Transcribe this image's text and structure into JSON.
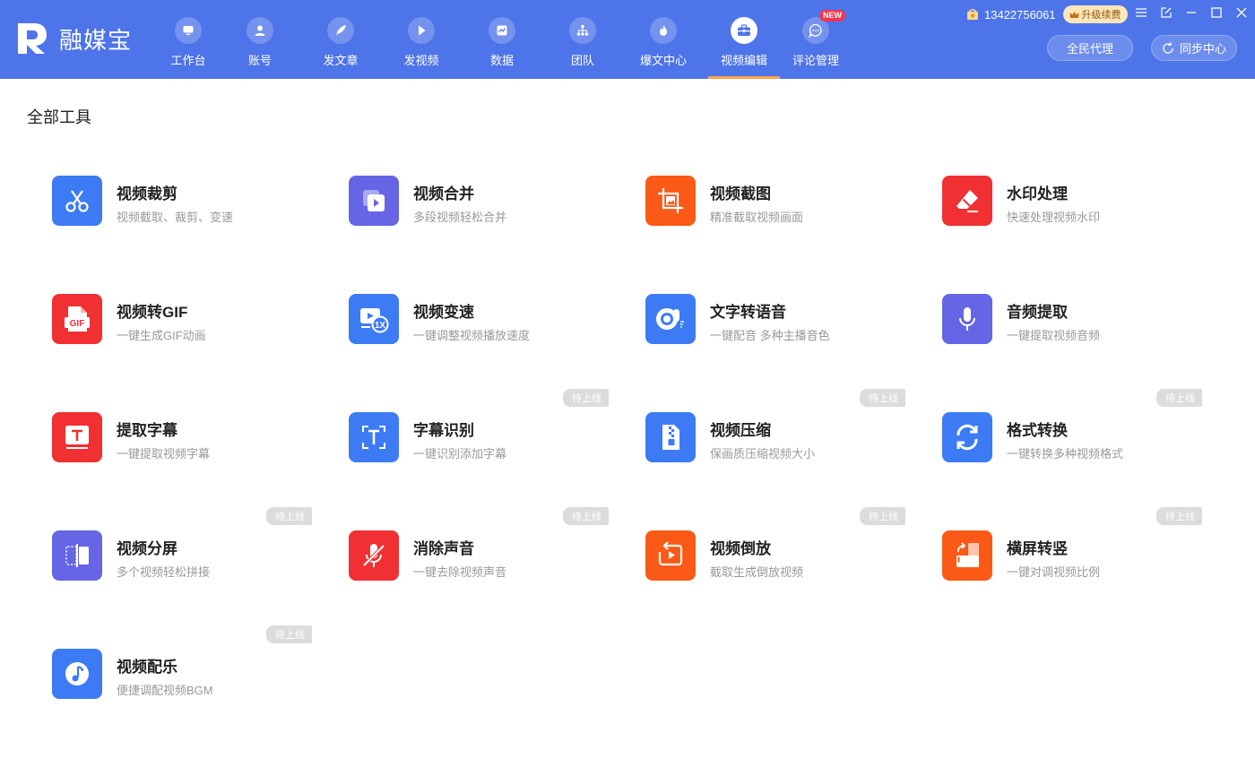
{
  "app": {
    "logo_text": "融媒宝"
  },
  "nav": [
    {
      "label": "工作台",
      "icon": "monitor-icon"
    },
    {
      "label": "账号",
      "icon": "user-icon"
    },
    {
      "label": "发文章",
      "icon": "feather-icon"
    },
    {
      "label": "发视频",
      "icon": "play-icon"
    },
    {
      "label": "数据",
      "icon": "chart-icon"
    },
    {
      "label": "团队",
      "icon": "team-icon"
    },
    {
      "label": "爆文中心",
      "icon": "flame-icon"
    },
    {
      "label": "视频编辑",
      "icon": "toolbox-icon",
      "active": true
    },
    {
      "label": "评论管理",
      "icon": "comment-icon",
      "badge": "NEW"
    }
  ],
  "account": {
    "phone": "13422756061",
    "upgrade_label": "升级续费"
  },
  "header_buttons": {
    "agent_label": "全民代理",
    "sync_label": "同步中心"
  },
  "section_title": "全部工具",
  "colors": {
    "topbar": "#4e74ea",
    "active_underline": "#ffa24a",
    "badge": "#f2364b"
  },
  "tools": [
    {
      "name": "视频裁剪",
      "desc": "视频截取、裁剪、变速",
      "icon": "scissors-icon",
      "color": "#3d7bf5",
      "soon": ""
    },
    {
      "name": "视频合并",
      "desc": "多段视频轻松合并",
      "icon": "merge-video-icon",
      "color": "#6565e6",
      "soon": ""
    },
    {
      "name": "视频截图",
      "desc": "精准截取视频画面",
      "icon": "crop-image-icon",
      "color": "#fa5a16",
      "soon": ""
    },
    {
      "name": "水印处理",
      "desc": "快速处理视频水印",
      "icon": "eraser-icon",
      "color": "#f03033",
      "soon": ""
    },
    {
      "name": "视频转GIF",
      "desc": "一键生成GIF动画",
      "icon": "gif-file-icon",
      "color": "#f03033",
      "soon": "",
      "glyph": "GIF"
    },
    {
      "name": "视频变速",
      "desc": "一键调整视频播放速度",
      "icon": "speed-icon",
      "color": "#3d7bf5",
      "soon": "",
      "glyph": "1X"
    },
    {
      "name": "文字转语音",
      "desc": "一键配音 多种主播音色",
      "icon": "voice-icon",
      "color": "#3d7bf5",
      "soon": ""
    },
    {
      "name": "音频提取",
      "desc": "一键提取视频音频",
      "icon": "microphone-icon",
      "color": "#6565e6",
      "soon": ""
    },
    {
      "name": "提取字幕",
      "desc": "一键提取视频字幕",
      "icon": "subtitle-icon",
      "color": "#f03033",
      "soon": "",
      "glyph": "T"
    },
    {
      "name": "字幕识别",
      "desc": "一键识别添加字幕",
      "icon": "text-scan-icon",
      "color": "#3d7bf5",
      "soon": "待上线",
      "glyph": "T"
    },
    {
      "name": "视频压缩",
      "desc": "保画质压缩视频大小",
      "icon": "zip-file-icon",
      "color": "#3d7bf5",
      "soon": "待上线"
    },
    {
      "name": "格式转换",
      "desc": "一键转换多种视频格式",
      "icon": "refresh-icon",
      "color": "#3d7bf5",
      "soon": "待上线"
    },
    {
      "name": "视频分屏",
      "desc": "多个视频轻松拼接",
      "icon": "split-screen-icon",
      "color": "#6565e6",
      "soon": "待上线"
    },
    {
      "name": "消除声音",
      "desc": "一键去除视频声音",
      "icon": "mute-mic-icon",
      "color": "#f03033",
      "soon": "待上线"
    },
    {
      "name": "视频倒放",
      "desc": "截取生成倒放视频",
      "icon": "reverse-play-icon",
      "color": "#fa5a16",
      "soon": "待上线"
    },
    {
      "name": "横屏转竖",
      "desc": "一键对调视频比例",
      "icon": "rotate-screen-icon",
      "color": "#fa5a16",
      "soon": "待上线"
    },
    {
      "name": "视频配乐",
      "desc": "便捷调配视频BGM",
      "icon": "music-note-icon",
      "color": "#3d7bf5",
      "soon": "待上线"
    }
  ]
}
